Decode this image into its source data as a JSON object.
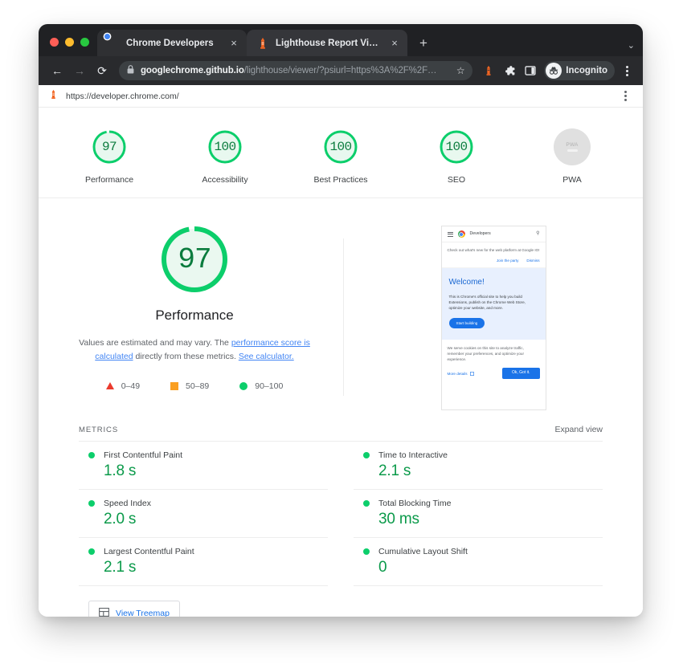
{
  "browser": {
    "tabs": [
      {
        "title": "Chrome Developers",
        "favicon": "chrome-logo-icon",
        "active": false
      },
      {
        "title": "Lighthouse Report Viewer",
        "favicon": "lighthouse-icon",
        "active": true
      }
    ],
    "new_tab_label": "+",
    "close_label": "×",
    "tab_list_chevron": "⌄",
    "nav": {
      "back": "←",
      "forward": "→",
      "reload": "⟳"
    },
    "omnibox": {
      "lock_icon": "lock-icon",
      "url_bold": "googlechrome.github.io",
      "url_rest": "/lighthouse/viewer/?psiurl=https%3A%2F%2F…",
      "star_icon": "☆"
    },
    "profile": {
      "label": "Incognito",
      "icon": "incognito-icon"
    },
    "menu_icon": "kebab-menu-icon"
  },
  "page_header": {
    "favicon": "lighthouse-icon",
    "url": "https://developer.chrome.com/",
    "menu_icon": "kebab-menu-icon"
  },
  "scores": [
    {
      "label": "Performance",
      "value": "97",
      "percent": 97,
      "type": "gauge"
    },
    {
      "label": "Accessibility",
      "value": "100",
      "percent": 100,
      "type": "gauge"
    },
    {
      "label": "Best Practices",
      "value": "100",
      "percent": 100,
      "type": "gauge"
    },
    {
      "label": "SEO",
      "value": "100",
      "percent": 100,
      "type": "gauge"
    },
    {
      "label": "PWA",
      "value": "PWA",
      "percent": 0,
      "type": "badge"
    }
  ],
  "performance": {
    "score": "97",
    "percent": 97,
    "title": "Performance",
    "description_parts": [
      "Values are estimated and may vary. The ",
      "performance score is calculated",
      " directly from these metrics. ",
      "See calculator."
    ],
    "legend": [
      {
        "shape": "triangle",
        "range": "0–49",
        "color": "#eb3b2e"
      },
      {
        "shape": "square",
        "range": "50–89",
        "color": "#fa9f22"
      },
      {
        "shape": "circle",
        "range": "90–100",
        "color": "#0cce6b"
      }
    ]
  },
  "thumbnail": {
    "brand": "Developers",
    "search_icon": "search-icon",
    "menu_icon": "hamburger-icon",
    "notice": "Check out what's new for the web platform at Google IO!",
    "notice_actions": [
      "Join the party",
      "Dismiss"
    ],
    "hero_title": "Welcome!",
    "hero_body": "This is Chrome's official site to help you build Extensions, publish on the Chrome Web Store, optimize your website, and more.",
    "hero_cta": "Start building",
    "cookie_text": "We serve cookies on this site to analyze traffic, remember your preferences, and optimize your experience.",
    "cookie_link": "More details",
    "cookie_link_icon": "external-link-icon",
    "cookie_button": "Ok, Got it."
  },
  "metrics_section": {
    "title": "METRICS",
    "expand_label": "Expand view",
    "items": [
      {
        "name": "First Contentful Paint",
        "value": "1.8 s",
        "status": "pass"
      },
      {
        "name": "Time to Interactive",
        "value": "2.1 s",
        "status": "pass"
      },
      {
        "name": "Speed Index",
        "value": "2.0 s",
        "status": "pass"
      },
      {
        "name": "Total Blocking Time",
        "value": "30 ms",
        "status": "pass"
      },
      {
        "name": "Largest Contentful Paint",
        "value": "2.1 s",
        "status": "pass"
      },
      {
        "name": "Cumulative Layout Shift",
        "value": "0",
        "status": "pass"
      }
    ]
  },
  "treemap": {
    "label": "View Treemap",
    "icon": "treemap-icon"
  },
  "colors": {
    "pass_green": "#0cce6b",
    "value_green": "#0b9a4a",
    "score_text_green": "#0b7c3e",
    "average_orange": "#fa9f22",
    "fail_red": "#eb3b2e",
    "link_blue": "#1a73e8",
    "chrome_dark": "#202124"
  }
}
